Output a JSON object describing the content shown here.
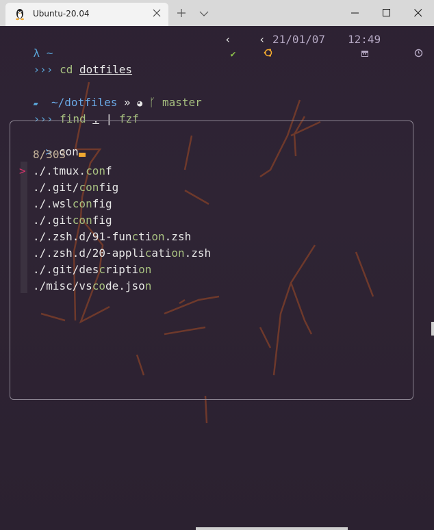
{
  "tab": {
    "title": "Ubuntu-20.04",
    "icon": "linux-tux-icon"
  },
  "window_controls": {
    "minimize": "minimize-icon",
    "maximize": "maximize-icon",
    "close": "close-icon"
  },
  "terminal": {
    "prompt1": {
      "lambda": "λ",
      "dir": "~"
    },
    "command1": {
      "arrows": "›››",
      "cmd": "cd",
      "arg": "dotfiles"
    },
    "status": {
      "check": "✔",
      "lt1": "‹",
      "lt2": "‹",
      "date": "21/01/07",
      "time": "12:49"
    },
    "prompt2": {
      "folder_icon": "folder-icon",
      "tilde": "~/",
      "dir": "dotfiles",
      "sep": "»",
      "git_icon": "git-cat-icon",
      "branch_icon": "branch-icon",
      "branch": "master"
    },
    "command2": {
      "arrows": "›››",
      "cmd": "find",
      "dot": ".",
      "pipe": "|",
      "arg": "fzf"
    }
  },
  "fzf": {
    "prompt_char": ">",
    "query": "con",
    "count": "8/303",
    "pointer": ">",
    "results": [
      {
        "pre": "./.tmux.",
        "m1": "con",
        "post": "f"
      },
      {
        "pre": "./.git/",
        "m1": "con",
        "post": "fig"
      },
      {
        "pre": "./.wsl",
        "m1": "con",
        "post": "fig"
      },
      {
        "pre": "./.git",
        "m1": "con",
        "post": "fig"
      },
      {
        "pre": "./.zsh.d/91-fun",
        "m1": "c",
        "mid": "ti",
        "m2": "on",
        "post": ".zsh"
      },
      {
        "pre": "./.zsh.d/20-appli",
        "m1": "c",
        "mid": "ati",
        "m2": "on",
        "post": ".zsh"
      },
      {
        "pre": "./.git/des",
        "m1": "c",
        "mid": "ripti",
        "m2": "on",
        "post": ""
      },
      {
        "pre": "./misc/vs",
        "m1": "co",
        "mid": "de.jso",
        "m2": "n",
        "post": ""
      }
    ]
  },
  "colors": {
    "accent_blue": "#5aa6d9",
    "match_green": "#a7c080",
    "pointer_red": "#d6336c",
    "cursor_orange": "#f0a830"
  }
}
